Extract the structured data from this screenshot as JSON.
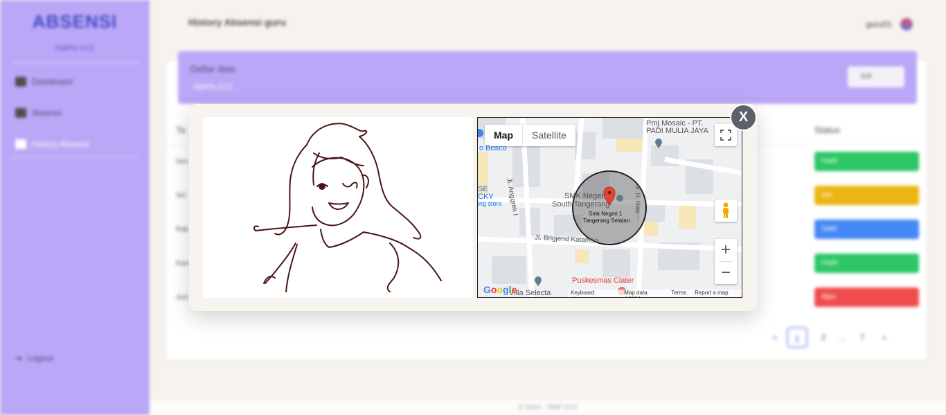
{
  "sidebar": {
    "brand": "ABSENSI",
    "subtitle": "SMPN XYZ",
    "items": [
      {
        "label": "Dashboard",
        "icon": "dashboard-icon"
      },
      {
        "label": "Absensi",
        "icon": "user-check-icon"
      },
      {
        "label": "History Absensi",
        "icon": "history-icon"
      }
    ],
    "logout": "Logout"
  },
  "header": {
    "title": "History Absensi guru",
    "username": "guru01"
  },
  "card": {
    "title": "Daftar data",
    "subtitle": "SMPN XYZ",
    "select_value": "Juli",
    "status_header": "Status",
    "first_col_header": "Ta",
    "rows": [
      {
        "label": "Sen",
        "status": "Hadir",
        "color": "#22c55e"
      },
      {
        "label": "Sel",
        "status": "Izin",
        "color": "#eab308"
      },
      {
        "label": "Rab",
        "status": "Sakit",
        "color": "#3b82f6"
      },
      {
        "label": "Kam",
        "status": "Hadir",
        "color": "#22c55e"
      },
      {
        "label": "Jum",
        "status": "Alpa",
        "color": "#ef4444"
      }
    ]
  },
  "pagination": {
    "prev": "«",
    "pages": [
      "1",
      "2",
      "...",
      "7"
    ],
    "next": "»"
  },
  "footer": "© 2024 - SMP XYZ",
  "modal": {
    "close_label": "X",
    "map": {
      "type_map": "Map",
      "type_satellite": "Satellite",
      "zoom_in": "+",
      "zoom_out": "−",
      "labels": {
        "place1": "Pmj Mosaic - PT.",
        "place1b": "PADI MULIA JAYA",
        "bosco": "o Bosco",
        "anggrek": "Jl. Anggrek I",
        "smk1": "SMK Negeri",
        "smk2": "South Tangerang",
        "marker1": "Smk Negeri 1",
        "marker2": "Tangerang Selatan",
        "brigjend": "Jl. Brigjend Katamso",
        "store1": "SE",
        "store2": "CKY",
        "store3": "ing store",
        "puskesmas": "Puskesmas Ciater",
        "villa": "Villa Selecta",
        "naw": "Jl. H. Naw"
      },
      "attribution": {
        "keyboard": "Keyboard shortcuts",
        "data": "Map data ©2024",
        "terms": "Terms",
        "report": "Report a map error"
      }
    }
  }
}
